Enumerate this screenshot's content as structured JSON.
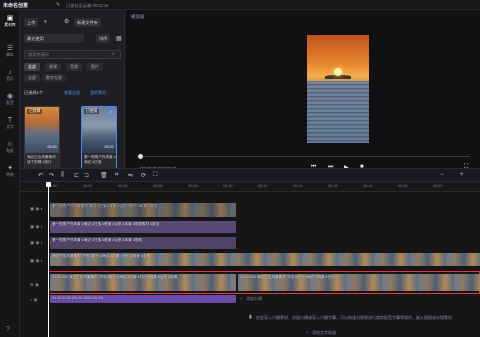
{
  "header": {
    "title": "未命名创意",
    "save_status": "已保存至云端 09:02:16"
  },
  "nav": {
    "items": [
      {
        "label": "素材库",
        "icon": "media-icon"
      },
      {
        "label": "脚本",
        "icon": "script-icon"
      },
      {
        "label": "音乐",
        "icon": "music-icon"
      },
      {
        "label": "配音",
        "icon": "voiceover-icon"
      },
      {
        "label": "文字",
        "icon": "text-icon"
      },
      {
        "label": "贴纸",
        "icon": "sticker-icon"
      },
      {
        "label": "特效",
        "icon": "effects-icon"
      }
    ]
  },
  "media": {
    "upload_label": "上传",
    "new_folder_label": "新建文件夹",
    "recent_label": "最近使用",
    "sort_label": "排序",
    "search_placeholder": "搜索关键词",
    "filters": [
      "全部",
      "视频",
      "音频",
      "图片"
    ],
    "filters2": [
      "全部",
      "数字分身"
    ],
    "section": "已选择1个",
    "link_all": "查看全部",
    "link_mine": "我的素材",
    "cards": [
      {
        "tag": "已剪辑",
        "duration": "00:21",
        "caption": "海边日出风景素材 适于剪辑 #旅行"
      },
      {
        "tag": "已使用",
        "duration": "00:21",
        "caption": "第一视角户外风景 #海边 #日落"
      }
    ]
  },
  "preview": {
    "title": "播放器",
    "time": "00:00:00/00:09:00"
  },
  "ruler": {
    "ticks": [
      "00:00",
      "00:02",
      "00:04",
      "00:06",
      "00:08",
      "00:10",
      "00:12",
      "00:14",
      "00:16",
      "00:18",
      "00:20",
      "00:22"
    ]
  },
  "timeline": {
    "clip1": "海边日出风景素材 夕阳 #旅行 #海边 #风景 #日出 #唯美 #治愈",
    "clip2": "海边日出风景素材 夕阳 #旅行 #海边 #风景 #日出 #唯美 #治愈 #视频剪辑",
    "text1": "第一视角户外风景素材 海边 #日落 #唯美 #治愈 #旅行 #风景 #原创",
    "text2": "第一视角户外风景 #海边 #日落 #唯美 #治愈 #风景 #视频素材 #原创",
    "text3": "第一视角户外风景 #海边 #日落 #唯美 #治愈 #风景 #视频",
    "main_label": "00:01:000 海边日出风景素材 夕阳 #旅行 #海边 #风景 #日出 #唯美 #治愈 #剪辑",
    "main_label2": "00:01:000 海边日出风景素材 夕阳 #旅行 #海边 #风景 #日出",
    "audio_label": "01 00:01:00 (00:00:10/00:00:00)",
    "add_segment": "添加分镜",
    "hint": "在此导入口播素材、封面口播或导入口播字幕，可以快速对视频进行裁剪配音字幕等操作，嵌入插图或分镜素材",
    "add_text": "添加文字轨道"
  }
}
